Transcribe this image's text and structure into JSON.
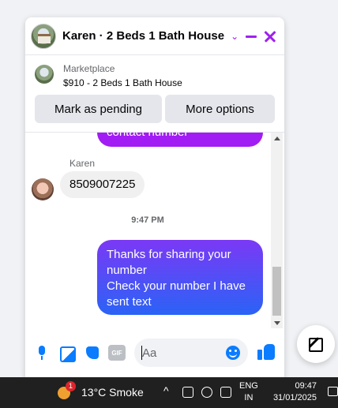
{
  "chat": {
    "header_title": "Karen · 2 Beds 1 Bath House",
    "chevron_glyph": "⌄",
    "listing": {
      "source": "Marketplace",
      "title": "$910 - 2 Beds 1 Bath House",
      "mark_pending_label": "Mark as pending",
      "more_options_label": "More options"
    },
    "messages": {
      "partial_outgoing": "contact number",
      "sender_name": "Karen",
      "incoming_text": "8509007225",
      "timestamp": "9:47 PM",
      "outgoing_line1": "Thanks for sharing your",
      "outgoing_line2": "number",
      "outgoing_line3": "Check your number I have",
      "outgoing_line4": "sent text"
    },
    "composer": {
      "placeholder": "Aa",
      "gif_label": "GIF"
    },
    "colors": {
      "accent": "#a020f0",
      "messenger_blue": "#0a7cff",
      "outgoing_gradient_top": "#7b39f5",
      "outgoing_gradient_bottom": "#2a63f6"
    }
  },
  "taskbar": {
    "weather_badge": "1",
    "weather": "13°C  Smoke",
    "tray_chevron": "^",
    "lang_line1": "ENG",
    "lang_line2": "IN",
    "time": "09:47",
    "date": "31/01/2025"
  }
}
